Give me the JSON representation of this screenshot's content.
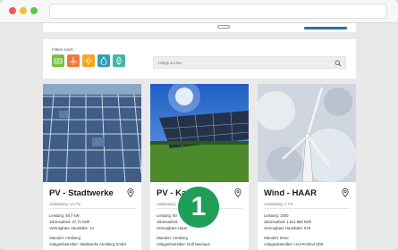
{
  "filter": {
    "label": "Filtern nach:",
    "buttons": [
      {
        "name": "pv-filter",
        "color": "#78c043"
      },
      {
        "name": "wind-filter",
        "color": "#f07a3c"
      },
      {
        "name": "sun-filter",
        "color": "#f5a623"
      },
      {
        "name": "hydro-filter",
        "color": "#2aa1b8"
      },
      {
        "name": "bio-filter",
        "color": "#43b7a8"
      }
    ]
  },
  "search": {
    "placeholder": "Anlage suchen"
  },
  "cards": [
    {
      "title": "PV - Stadtwerke",
      "utilization": "Auslastung: 14,7%",
      "performance": "Leistung: 49,7 kW",
      "annual": "Jahresarbeit: 37,71 kWh",
      "households": "Versorgbare Haushalte: 13",
      "location": "Standort: Arnsberg",
      "operator": "Anlagenbetreiber: Stadtwerke Arnsberg GmbH"
    },
    {
      "title": "PV - Ka",
      "utilization": "Auslastung:",
      "performance": "Leistung: 50",
      "annual": "Jahresarbeit:",
      "households": "Versorgbare Haus",
      "location": "Standort: Arnsberg",
      "operator": "Anlagenbetreiber: Rolf Neuhaus"
    },
    {
      "title": "Wind - HAAR",
      "utilization": "Auslastung: 7,7%",
      "performance": "Leistung: 1000",
      "annual": "Jahresarbeit: 1.811.858 kWh",
      "households": "Versorgbare Haushalte: 576",
      "location": "Standort: Ense",
      "operator": "Anlagenbetreiber: HAAR-Wind GbR"
    }
  ],
  "badge": {
    "number": "1",
    "color": "#1e9e58"
  }
}
